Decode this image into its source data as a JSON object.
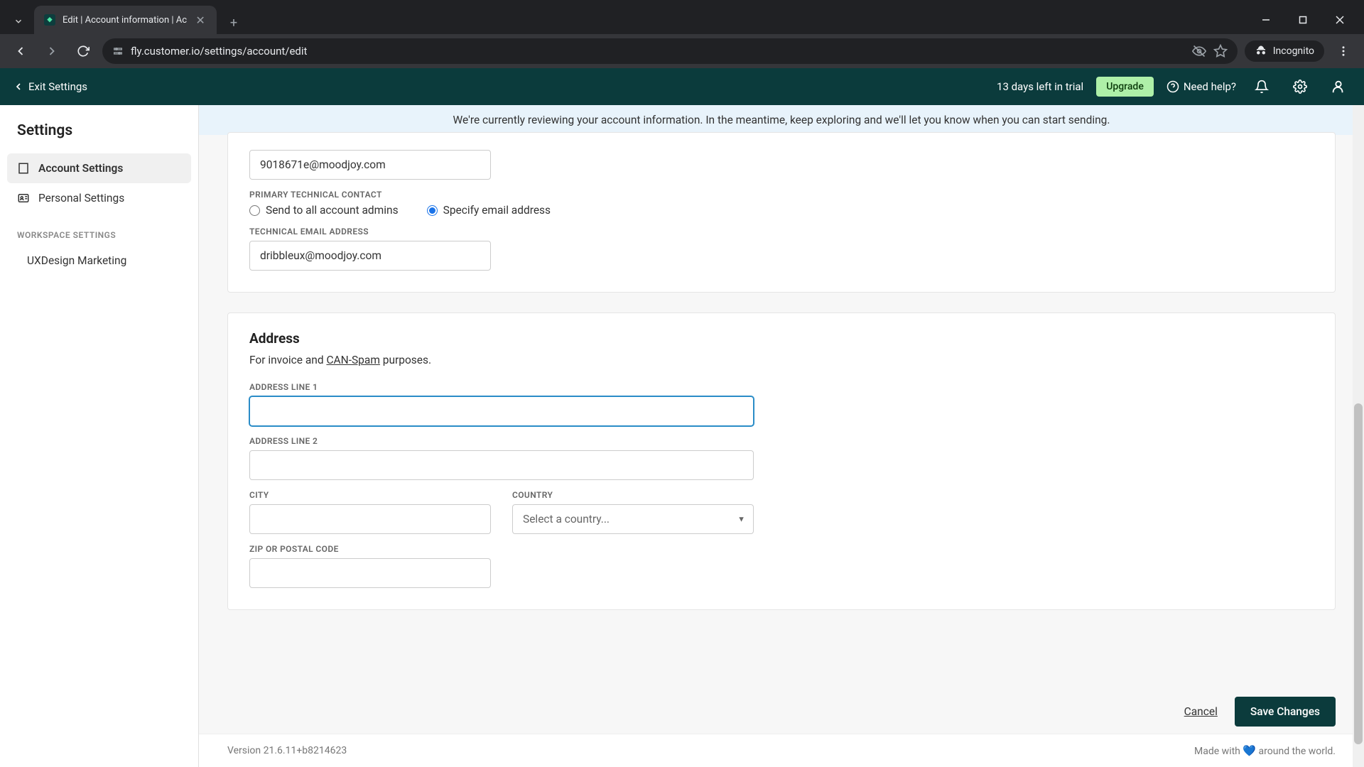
{
  "browser": {
    "tab_title": "Edit | Account information | Ac",
    "url": "fly.customer.io/settings/account/edit",
    "incognito_label": "Incognito"
  },
  "header": {
    "exit_label": "Exit Settings",
    "trial_text": "13 days left in trial",
    "upgrade_label": "Upgrade",
    "help_label": "Need help?"
  },
  "sidebar": {
    "title": "Settings",
    "items": [
      {
        "label": "Account Settings",
        "active": true
      },
      {
        "label": "Personal Settings",
        "active": false
      }
    ],
    "workspace_label": "WORKSPACE SETTINGS",
    "workspace_item": "UXDesign Marketing"
  },
  "banner": "We're currently reviewing your account information. In the meantime, keep exploring and we'll let you know when you can start sending.",
  "form": {
    "email_value": "9018671e@moodjoy.com",
    "tech_contact_label": "PRIMARY TECHNICAL CONTACT",
    "radio_all_admins": "Send to all account admins",
    "radio_specify": "Specify email address",
    "tech_email_label": "TECHNICAL EMAIL ADDRESS",
    "tech_email_value": "dribbleux@moodjoy.com",
    "address_title": "Address",
    "address_desc_pre": "For invoice and ",
    "address_desc_link": "CAN-Spam",
    "address_desc_post": " purposes.",
    "addr1_label": "ADDRESS LINE 1",
    "addr1_value": "",
    "addr2_label": "ADDRESS LINE 2",
    "addr2_value": "",
    "city_label": "CITY",
    "city_value": "",
    "country_label": "COUNTRY",
    "country_placeholder": "Select a country...",
    "zip_label": "ZIP OR POSTAL CODE",
    "zip_value": ""
  },
  "actions": {
    "cancel": "Cancel",
    "save": "Save Changes"
  },
  "footer": {
    "version": "Version 21.6.11+b8214623",
    "made_pre": "Made with ",
    "made_post": " around the world."
  }
}
